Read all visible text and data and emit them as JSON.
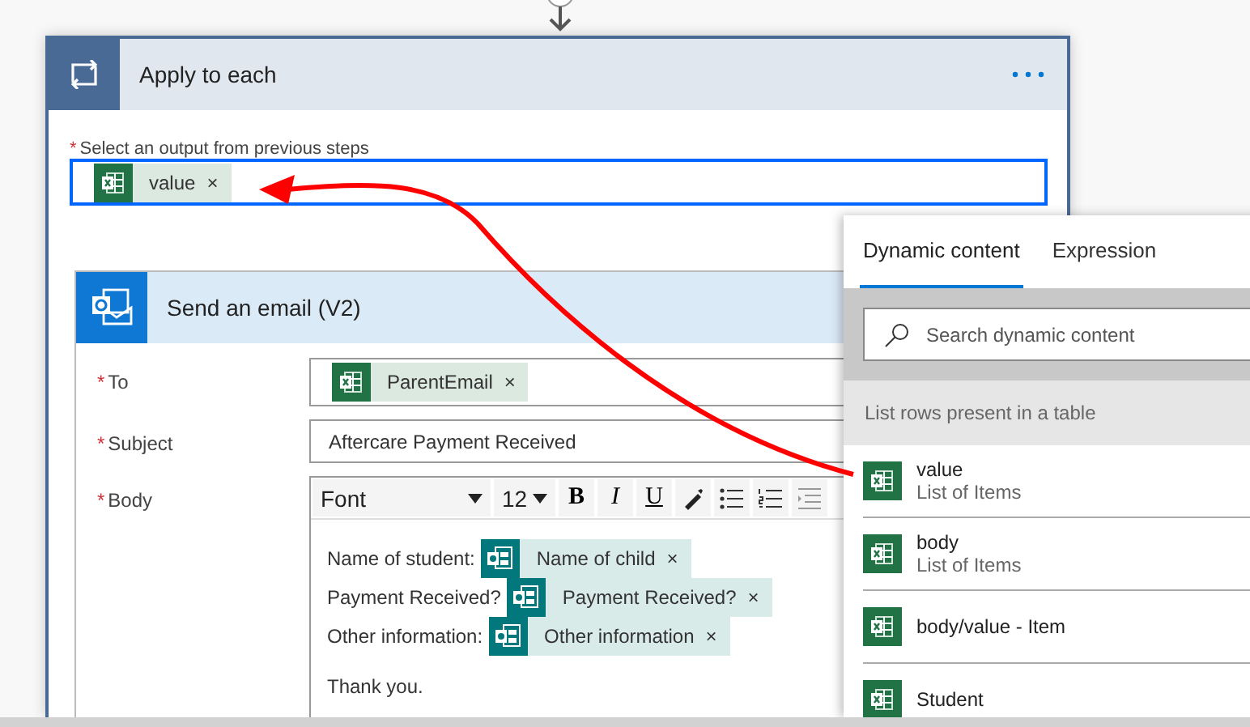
{
  "required_mark": "*",
  "loop": {
    "title": "Apply to each",
    "field": {
      "label": "Select an output from previous steps",
      "required": true,
      "focused": true,
      "tokens": [
        {
          "text": "value",
          "remove": "×",
          "kind": "sheet"
        }
      ]
    }
  },
  "action": {
    "title": "Send an email (V2)",
    "fields": [
      {
        "label": "To",
        "required": true,
        "kind": "tokens",
        "tokens": [
          {
            "text": "ParentEmail",
            "remove": "×",
            "kind": "sheet"
          }
        ]
      },
      {
        "label": "Subject",
        "required": true,
        "kind": "text",
        "value": "Aftercare Payment Received"
      },
      {
        "label": "Body",
        "required": true,
        "kind": "editor",
        "font": "Font",
        "size": "12",
        "format_buttons": [
          "B",
          "I",
          "U"
        ],
        "lines": [
          {
            "text": "Name of student:",
            "token": {
              "text": "Name of child",
              "remove": "×",
              "kind": "form"
            }
          },
          {
            "text": "Payment Received?",
            "token": {
              "text": "Payment Received?",
              "remove": "×",
              "kind": "form"
            }
          },
          {
            "text": "Other information:",
            "token": {
              "text": "Other information",
              "remove": "×",
              "kind": "form"
            }
          }
        ],
        "closing": "Thank you."
      }
    ]
  },
  "panel": {
    "tabs": [
      {
        "label": "Dynamic content",
        "selected": true
      },
      {
        "label": "Expression",
        "selected": false
      }
    ],
    "search": {
      "placeholder": "Search dynamic content"
    },
    "section": "List rows present in a table",
    "items": [
      {
        "name": "value",
        "description": "List of Items"
      },
      {
        "name": "body",
        "description": "List of Items"
      },
      {
        "name": "body/value - Item"
      },
      {
        "name": "Student"
      }
    ]
  }
}
